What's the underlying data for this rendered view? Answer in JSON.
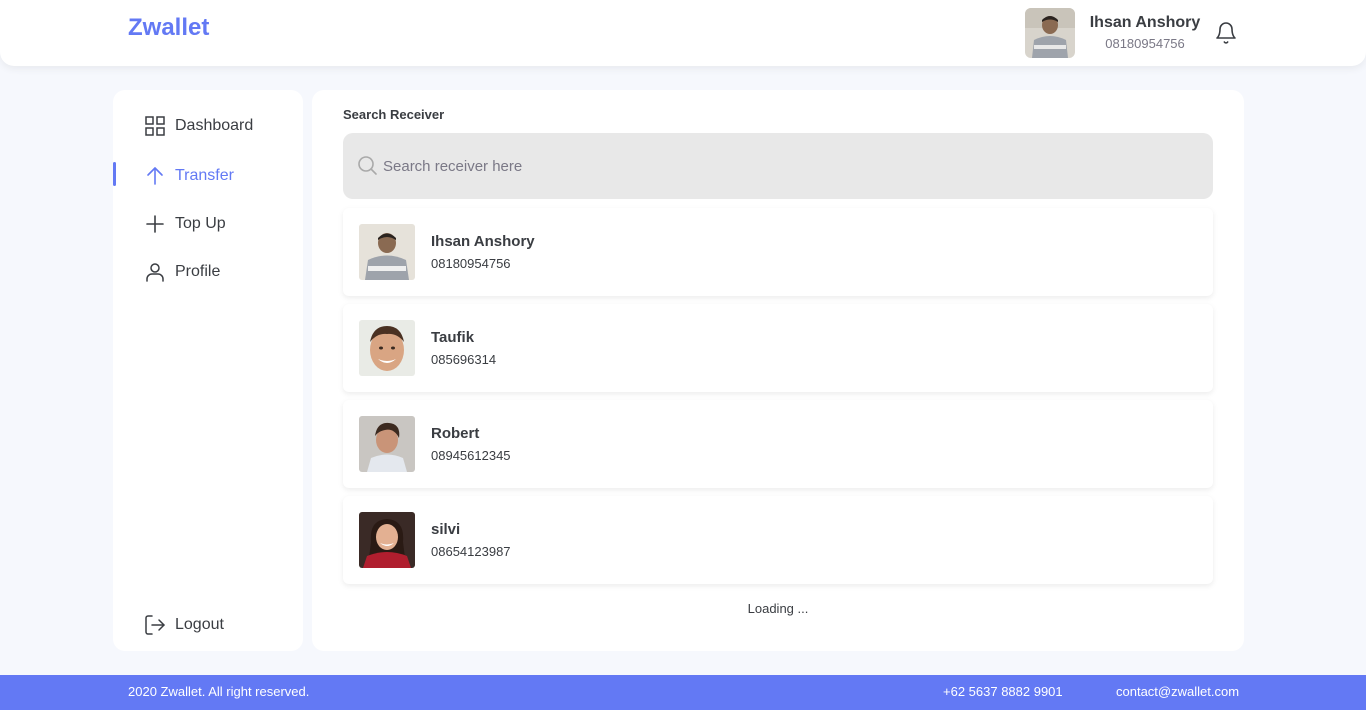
{
  "header": {
    "brand": "Zwallet",
    "user_name": "Ihsan Anshory",
    "user_phone": "08180954756",
    "icons": [
      "avatar",
      "bell-icon"
    ]
  },
  "sidebar": {
    "items": [
      {
        "label": "Dashboard",
        "icon": "grid-icon",
        "active": false
      },
      {
        "label": "Transfer",
        "icon": "arrow-up-icon",
        "active": true
      },
      {
        "label": "Top Up",
        "icon": "plus-icon",
        "active": false
      },
      {
        "label": "Profile",
        "icon": "user-icon",
        "active": false
      }
    ],
    "logout_label": "Logout"
  },
  "main": {
    "title": "Search Receiver",
    "search": {
      "placeholder": "Search receiver here",
      "value": ""
    },
    "contacts": [
      {
        "name": "Ihsan Anshory",
        "phone": "08180954756"
      },
      {
        "name": "Taufik",
        "phone": "085696314"
      },
      {
        "name": "Robert",
        "phone": "08945612345"
      },
      {
        "name": "silvi",
        "phone": "08654123987"
      }
    ],
    "loading_text": "Loading ..."
  },
  "footer": {
    "copyright": "2020 Zwallet. All right reserved.",
    "phone": "+62 5637 8882 9901",
    "email": "contact@zwallet.com"
  },
  "colors": {
    "accent": "#6379F4",
    "background": "#F6F8FD",
    "text": "#3A3D42",
    "muted": "#7A7886",
    "search_bg": "#E8E8E8"
  }
}
